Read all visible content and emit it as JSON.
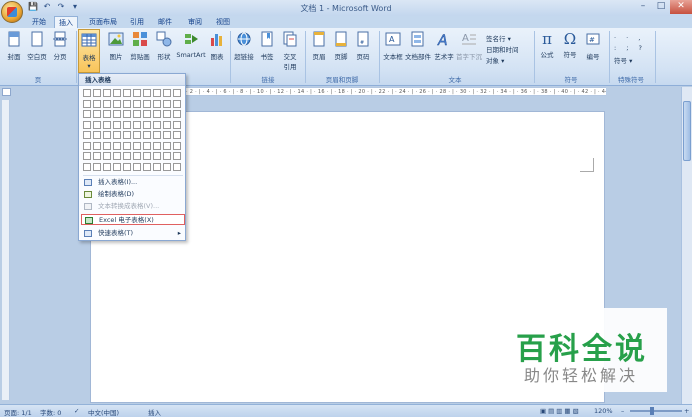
{
  "window": {
    "title": "文档 1 - Microsoft Word"
  },
  "quick_access": {
    "save": "💾",
    "undo": "↶",
    "redo": "↷",
    "more": "▾"
  },
  "window_buttons": {
    "minimize": "–",
    "maximize": "□",
    "close": "✕"
  },
  "tabs": [
    {
      "label": "开始"
    },
    {
      "label": "插入"
    },
    {
      "label": "页面布局"
    },
    {
      "label": "引用"
    },
    {
      "label": "邮件"
    },
    {
      "label": "审阅"
    },
    {
      "label": "视图"
    }
  ],
  "ribbon": {
    "pages": {
      "cover": "封面",
      "blank": "空白页",
      "break": "分页",
      "label": "页"
    },
    "table": {
      "table": "表格",
      "arrow": "▾"
    },
    "illustrations": {
      "picture": "图片",
      "clipart": "剪贴画",
      "shapes": "形状",
      "smartart": "SmartArt",
      "chart": "图表",
      "label": "插图"
    },
    "links": {
      "hyperlink": "超链接",
      "bookmark": "书签",
      "crossref_1": "交叉",
      "crossref_2": "引用",
      "label": "链接"
    },
    "header_footer": {
      "header": "页眉",
      "footer": "页脚",
      "pagenum": "页码",
      "label": "页眉和页脚"
    },
    "text": {
      "textbox": "文本框",
      "quickparts": "文档部件",
      "wordart": "艺术字",
      "dropcap": "首字下沉",
      "signature": "签名行 ▾",
      "datetime": "日期和时间",
      "object": "对象 ▾",
      "label": "文本"
    },
    "symbols": {
      "equation": "公式",
      "symbol": "符号",
      "number": "编号",
      "label": "符号"
    },
    "special": {
      "symbol": "符号 ▾",
      "label": "特殊符号"
    }
  },
  "ruler": {
    "ticks": "· 2 · | · 4 · | · 6 · | · 8 · | · 10 · | · 12 · | · 14 · | · 16 · | · 18 · | · 20 · | · 22 · | · 24 · | · 26 · | · 28 · | · 30 · | · 32 · | · 34 · | · 36 · | · 38 · | · 40 · | · 42 · | · 44 · | · 46 · | · 48 · | · 50 · | · 52 · |"
  },
  "dropdown": {
    "header": "插入表格",
    "items": [
      {
        "label": "插入表格(I)..."
      },
      {
        "label": "绘制表格(D)"
      },
      {
        "label": "文本转换成表格(V)..."
      },
      {
        "label": "Excel 电子表格(X)"
      },
      {
        "label": "快速表格(T)"
      }
    ],
    "submenu_arrow": "▸"
  },
  "statusbar": {
    "page": "页面: 1/1",
    "words": "字数: 0",
    "language": "中文(中国)",
    "mode": "插入",
    "zoom": "120%",
    "zoom_minus": "–",
    "zoom_plus": "+"
  },
  "watermark": {
    "title": "百科全说",
    "subtitle": "助你轻松解决"
  }
}
